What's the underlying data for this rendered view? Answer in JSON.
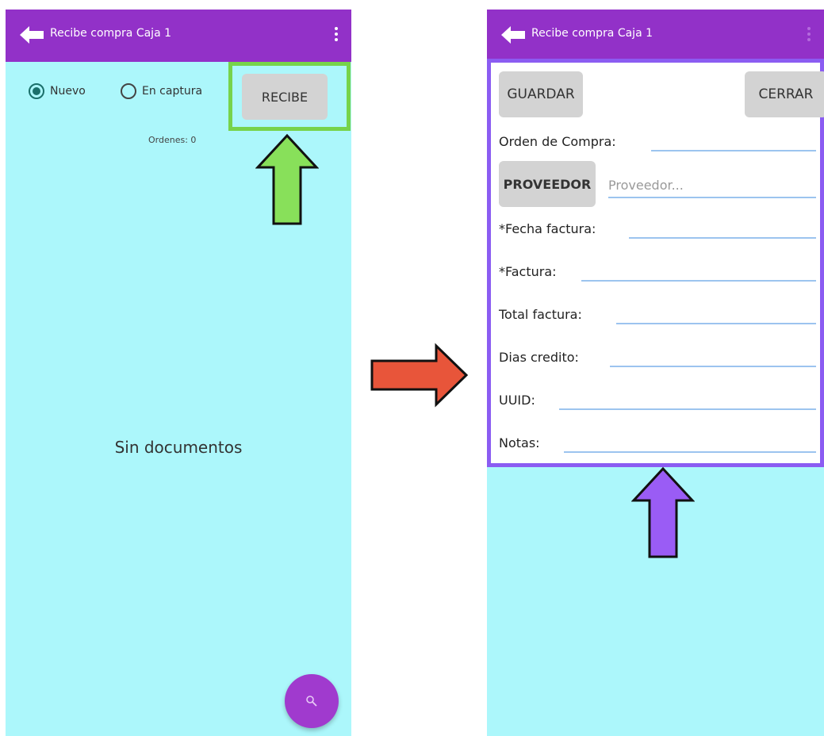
{
  "left_screen": {
    "appbar": {
      "title": "Recibe compra Caja 1",
      "back_icon": "arrow-left-icon",
      "menu_icon": "more-vert-icon"
    },
    "radios": [
      {
        "label": "Nuevo",
        "checked": true
      },
      {
        "label": "En captura",
        "checked": false
      }
    ],
    "recibe_label": "RECIBE",
    "ordenes_text": "Ordenes: 0",
    "empty_message": "Sin documentos",
    "fab_icon": "search-icon"
  },
  "right_screen": {
    "appbar": {
      "title": "Recibe compra Caja 1",
      "back_icon": "arrow-left-icon",
      "menu_icon": "more-vert-icon"
    },
    "guardar_label": "GUARDAR",
    "cerrar_label": "CERRAR",
    "proveedor_label": "PROVEEDOR",
    "proveedor_placeholder": "Proveedor...",
    "fields": [
      {
        "label": "Orden de Compra:",
        "value": ""
      },
      {
        "label": "*Fecha factura:",
        "value": ""
      },
      {
        "label": "*Factura:",
        "value": ""
      },
      {
        "label": "Total factura:",
        "value": ""
      },
      {
        "label": "Dias credito:",
        "value": ""
      },
      {
        "label": "UUID:",
        "value": ""
      },
      {
        "label": "Notas:",
        "value": ""
      }
    ]
  },
  "colors": {
    "appbar": "#9231c8",
    "background": "#acf7fb",
    "highlight_green": "#77d34a",
    "highlight_purple": "#8b5cf2",
    "arrow_red": "#e8553a",
    "arrow_green": "#88e05a",
    "arrow_purple": "#9a5cf5"
  }
}
